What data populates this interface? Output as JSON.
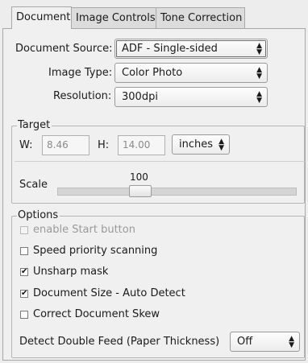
{
  "tabs": [
    {
      "label": "Document"
    },
    {
      "label": "Image Controls"
    },
    {
      "label": "Tone Correction"
    }
  ],
  "document": {
    "source_label": "Document Source:",
    "source_value": "ADF - Single-sided",
    "image_type_label": "Image Type:",
    "image_type_value": "Color Photo",
    "resolution_label": "Resolution:",
    "resolution_value": "300dpi"
  },
  "target": {
    "title": "Target",
    "w_label": "W:",
    "w_value": "8.46",
    "h_label": "H:",
    "h_value": "14.00",
    "unit_value": "inches",
    "scale_label": "Scale",
    "scale_value": "100"
  },
  "options": {
    "title": "Options",
    "items": [
      {
        "label": "enable Start button",
        "checked": false,
        "enabled": false
      },
      {
        "label": "Speed priority scanning",
        "checked": false,
        "enabled": true
      },
      {
        "label": "Unsharp mask",
        "checked": true,
        "enabled": true
      },
      {
        "label": "Document Size - Auto Detect",
        "checked": true,
        "enabled": true
      },
      {
        "label": "Correct Document Skew",
        "checked": false,
        "enabled": true
      }
    ],
    "double_feed_label": "Detect Double Feed (Paper Thickness)",
    "double_feed_value": "Off"
  },
  "glyphs": {
    "combo_arrows": "▲▼",
    "check_mark": "✔"
  }
}
